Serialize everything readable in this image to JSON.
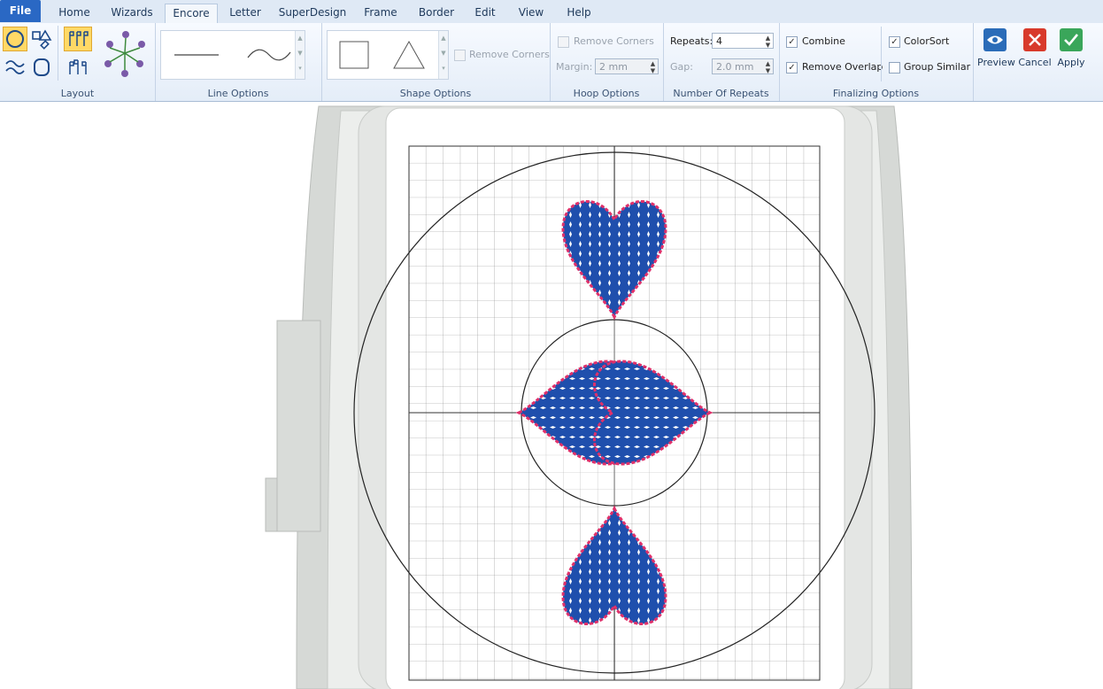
{
  "tabs": [
    {
      "label": "File"
    },
    {
      "label": "Home"
    },
    {
      "label": "Wizards"
    },
    {
      "label": "Encore"
    },
    {
      "label": "Letter"
    },
    {
      "label": "SuperDesign"
    },
    {
      "label": "Frame"
    },
    {
      "label": "Border"
    },
    {
      "label": "Edit"
    },
    {
      "label": "View"
    },
    {
      "label": "Help"
    }
  ],
  "active_tab": "Encore",
  "groups": {
    "layout": "Layout",
    "line_options": "Line Options",
    "shape_options": "Shape Options",
    "hoop_options": "Hoop Options",
    "number_of_repeats": "Number Of Repeats",
    "finalizing_options": "Finalizing Options"
  },
  "shape_options": {
    "remove_corners": "Remove Corners",
    "remove_corners_checked": false
  },
  "hoop_options": {
    "remove_corners": "Remove Corners",
    "remove_corners_checked": false,
    "margin_label": "Margin:",
    "margin_value": "2 mm"
  },
  "repeats": {
    "repeats_label": "Repeats:",
    "repeats_value": "4",
    "gap_label": "Gap:",
    "gap_value": "2.0 mm"
  },
  "finalizing": {
    "combine": "Combine",
    "combine_checked": true,
    "remove_overlap": "Remove Overlap",
    "remove_overlap_checked": true,
    "colorsort": "ColorSort",
    "colorsort_checked": true,
    "group_similar": "Group Similar",
    "group_similar_checked": false
  },
  "actions": {
    "preview": "Preview",
    "cancel": "Cancel",
    "apply": "Apply"
  },
  "colors": {
    "tab_active": "#f3f7fc",
    "file_tab": "#2a68c4",
    "heart_fill": "#1f4fad",
    "heart_stitch": "#e0306a",
    "preview_icon": "#2b6cb8",
    "cancel_icon": "#d83a2b",
    "apply_icon": "#3aa65a"
  },
  "design": {
    "shape": "heart",
    "repeats": 4,
    "layout": "circle"
  }
}
